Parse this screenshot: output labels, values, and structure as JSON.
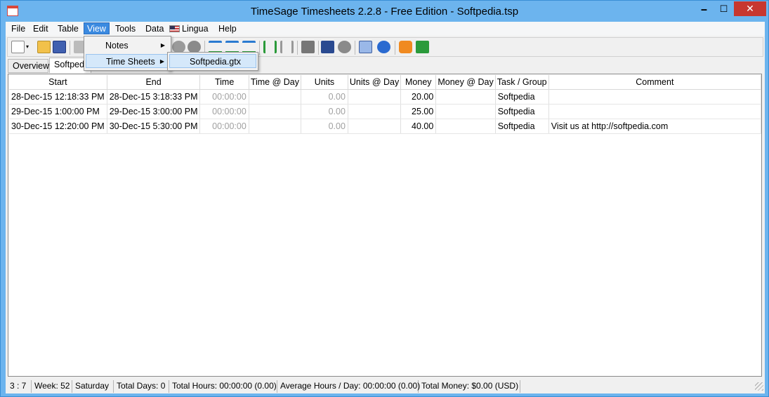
{
  "window": {
    "title": "TimeSage Timesheets 2.2.8 - Free Edition - Softpedia.tsp",
    "minimize_glyph": "🗕",
    "maximize_glyph": "☐",
    "close_glyph": "✕"
  },
  "menubar": {
    "items": [
      "File",
      "Edit",
      "Table",
      "View",
      "Tools",
      "Data",
      "Lingua",
      "Help"
    ],
    "active": "View"
  },
  "view_menu": {
    "items": [
      {
        "label": "Notes",
        "has_submenu": true
      },
      {
        "label": "Time Sheets",
        "has_submenu": true
      }
    ],
    "submenu_items": [
      "Softpedia.gtx"
    ]
  },
  "tabs": {
    "items": [
      "Overview",
      "Softpedia"
    ],
    "selected": "Softpedia"
  },
  "table": {
    "columns": [
      "Start",
      "End",
      "Time",
      "Time @ Day",
      "Units",
      "Units @ Day",
      "Money",
      "Money @ Day",
      "Task / Group",
      "Comment"
    ],
    "rows": [
      {
        "start": "28-Dec-15 12:18:33 PM",
        "end": "28-Dec-15 3:18:33 PM",
        "time": "00:00:00",
        "time_day": "",
        "units": "0.00",
        "units_day": "",
        "money": "20.00",
        "money_day": "",
        "task": "Softpedia",
        "comment": ""
      },
      {
        "start": "29-Dec-15 1:00:00 PM",
        "end": "29-Dec-15 3:00:00 PM",
        "time": "00:00:00",
        "time_day": "",
        "units": "0.00",
        "units_day": "",
        "money": "25.00",
        "money_day": "",
        "task": "Softpedia",
        "comment": ""
      },
      {
        "start": "30-Dec-15 12:20:00 PM",
        "end": "30-Dec-15 5:30:00 PM",
        "time": "00:00:00",
        "time_day": "",
        "units": "0.00",
        "units_day": "",
        "money": "40.00",
        "money_day": "",
        "task": "Softpedia",
        "comment": "Visit us at http://softpedia.com"
      }
    ]
  },
  "statusbar": {
    "position": "3 : 7",
    "week": "Week: 52",
    "day": "Saturday",
    "total_days": "Total Days: 0",
    "total_hours": "Total Hours: 00:00:00 (0.00)",
    "average_hours": "Average Hours / Day: 00:00:00 (0.00)",
    "total_money": "Total Money: $0.00 (USD)"
  },
  "colors": {
    "titlebar": "#6cb4ee",
    "close_button": "#c7372f",
    "menu_highlight": "#3b8ae0",
    "grey_value": "#a0a0a0"
  }
}
